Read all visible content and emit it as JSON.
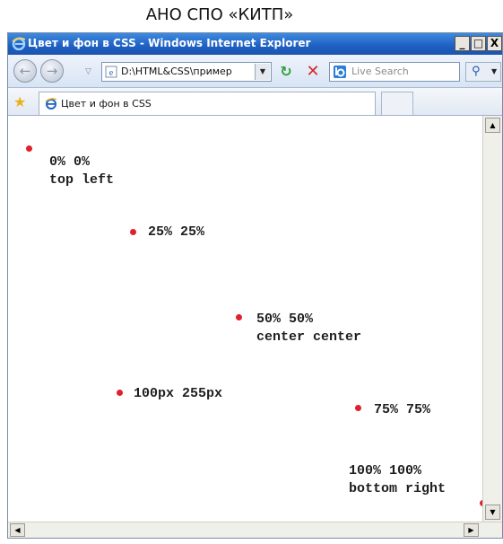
{
  "caption": "АНО СПО «КИТП»",
  "window": {
    "title": "Цвет и фон в CSS - Windows Internet Explorer",
    "min_label": "_",
    "max_label": "□",
    "close_label": "X"
  },
  "navbar": {
    "back_icon": "back-arrow-icon",
    "forward_icon": "forward-arrow-icon",
    "address": "D:\\HTML&CSS\\пример",
    "search_placeholder": "Live Search"
  },
  "tabbar": {
    "favorites_icon": "star-icon",
    "tab_label": "Цвет и фон в CSS"
  },
  "content": {
    "dot_color": "#e0202c",
    "positions": [
      {
        "line1": "0% 0%",
        "line2": "top left"
      },
      {
        "line1": "25% 25%",
        "line2": ""
      },
      {
        "line1": "50% 50%",
        "line2": "center center"
      },
      {
        "line1": "100px 255px",
        "line2": ""
      },
      {
        "line1": "75% 75%",
        "line2": ""
      },
      {
        "line1": "100% 100%",
        "line2": "bottom right"
      }
    ]
  }
}
